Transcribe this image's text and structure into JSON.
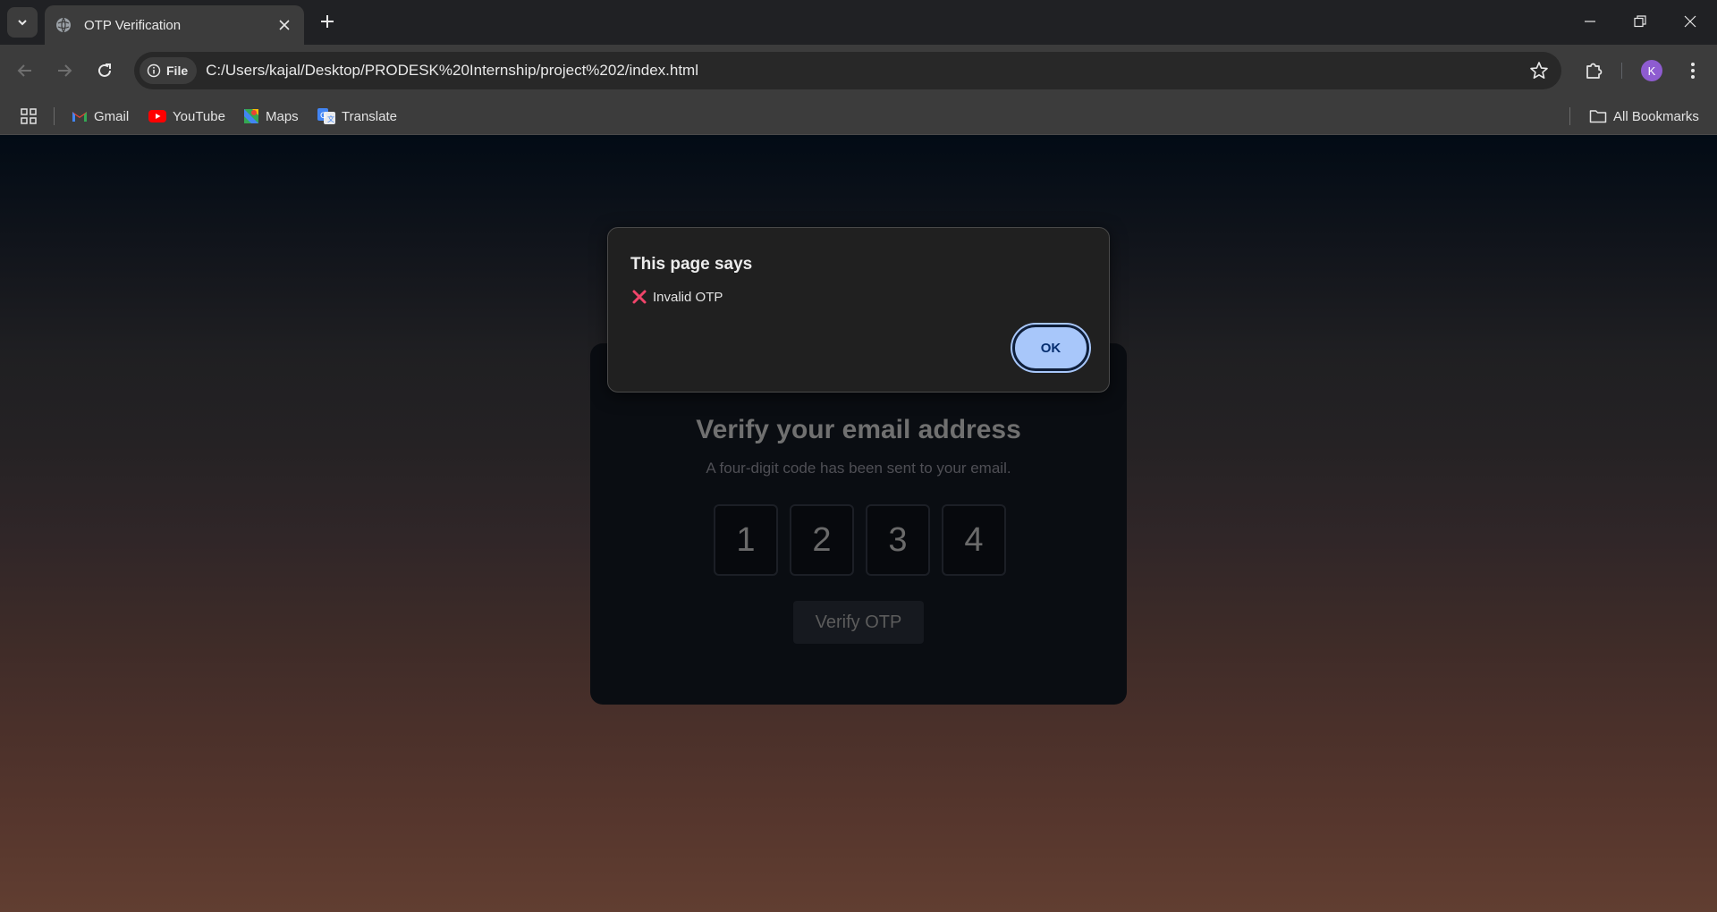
{
  "browser": {
    "tab_title": "OTP Verification",
    "address_chip": "File",
    "url": "C:/Users/kajal/Desktop/PRODESK%20Internship/project%202/index.html",
    "profile_initial": "K"
  },
  "bookmarks": {
    "items": [
      {
        "label": "Gmail",
        "icon": "gmail-icon"
      },
      {
        "label": "YouTube",
        "icon": "youtube-icon"
      },
      {
        "label": "Maps",
        "icon": "maps-icon"
      },
      {
        "label": "Translate",
        "icon": "translate-icon"
      }
    ],
    "all_bookmarks": "All Bookmarks"
  },
  "card": {
    "title": "Verify your email address",
    "subtitle": "A four-digit code has been sent to your email.",
    "otp_digits": [
      "1",
      "2",
      "3",
      "4"
    ],
    "verify_label": "Verify OTP"
  },
  "dialog": {
    "title": "This page says",
    "message": "Invalid OTP",
    "message_icon": "cross-mark-icon",
    "ok_label": "OK"
  },
  "colors": {
    "accent": "#a8c7fa",
    "error_icon": "#f0446a",
    "avatar": "#8e5cd0"
  }
}
